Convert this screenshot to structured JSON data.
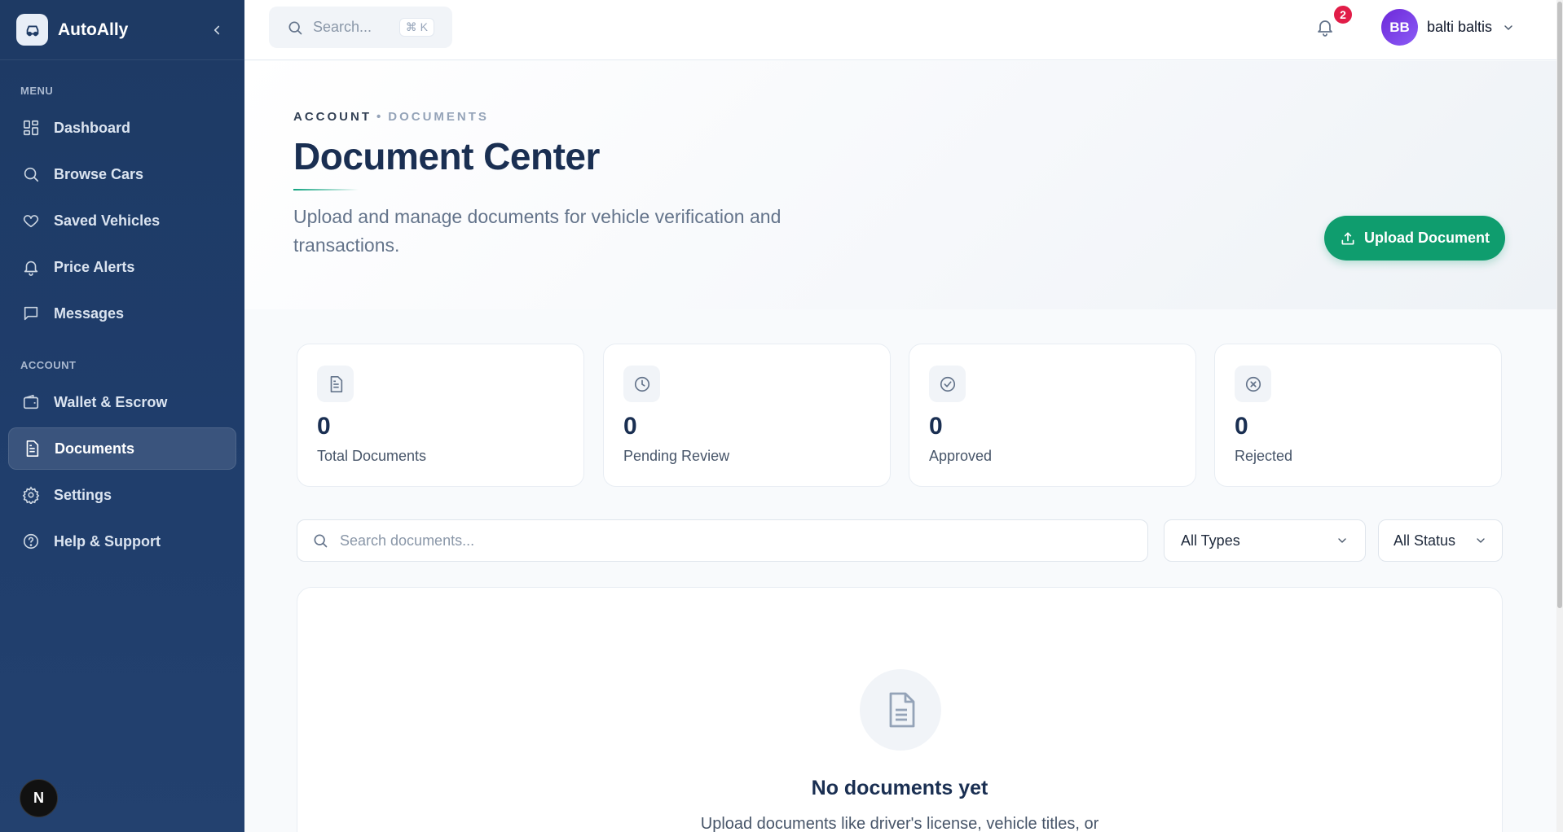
{
  "app": {
    "name": "AutoAlly"
  },
  "sidebar": {
    "menu_label": "MENU",
    "account_label": "ACCOUNT",
    "menu_items": [
      {
        "label": "Dashboard",
        "icon": "dashboard-icon"
      },
      {
        "label": "Browse Cars",
        "icon": "search-icon"
      },
      {
        "label": "Saved Vehicles",
        "icon": "heart-icon"
      },
      {
        "label": "Price Alerts",
        "icon": "bell-icon"
      },
      {
        "label": "Messages",
        "icon": "message-icon"
      }
    ],
    "account_items": [
      {
        "label": "Wallet & Escrow",
        "icon": "wallet-icon"
      },
      {
        "label": "Documents",
        "icon": "document-icon",
        "active": true
      },
      {
        "label": "Settings",
        "icon": "gear-icon"
      },
      {
        "label": "Help & Support",
        "icon": "help-icon"
      }
    ],
    "badge": "N"
  },
  "topbar": {
    "search_placeholder": "Search...",
    "shortcut": "⌘ K",
    "notifications_count": "2",
    "user_initials": "BB",
    "user_name": "balti baltis"
  },
  "hero": {
    "breadcrumb_parent": "ACCOUNT",
    "breadcrumb_current": "DOCUMENTS",
    "title": "Document Center",
    "subtitle": "Upload and manage documents for vehicle verification and transactions.",
    "upload_label": "Upload Document"
  },
  "stats": [
    {
      "value": "0",
      "label": "Total Documents",
      "icon": "document-icon"
    },
    {
      "value": "0",
      "label": "Pending Review",
      "icon": "clock-icon"
    },
    {
      "value": "0",
      "label": "Approved",
      "icon": "check-circle-icon"
    },
    {
      "value": "0",
      "label": "Rejected",
      "icon": "x-circle-icon"
    }
  ],
  "filters": {
    "search_placeholder": "Search documents...",
    "type_selected": "All Types",
    "status_selected": "All Status"
  },
  "empty": {
    "title": "No documents yet",
    "description": "Upload documents like driver's license, vehicle titles, or"
  },
  "colors": {
    "sidebar_bg": "#1e3a64",
    "accent_green": "#0f9d6e",
    "title_navy": "#1a2f52",
    "notification_red": "#e11d48",
    "avatar_purple": "#7c3aed"
  }
}
